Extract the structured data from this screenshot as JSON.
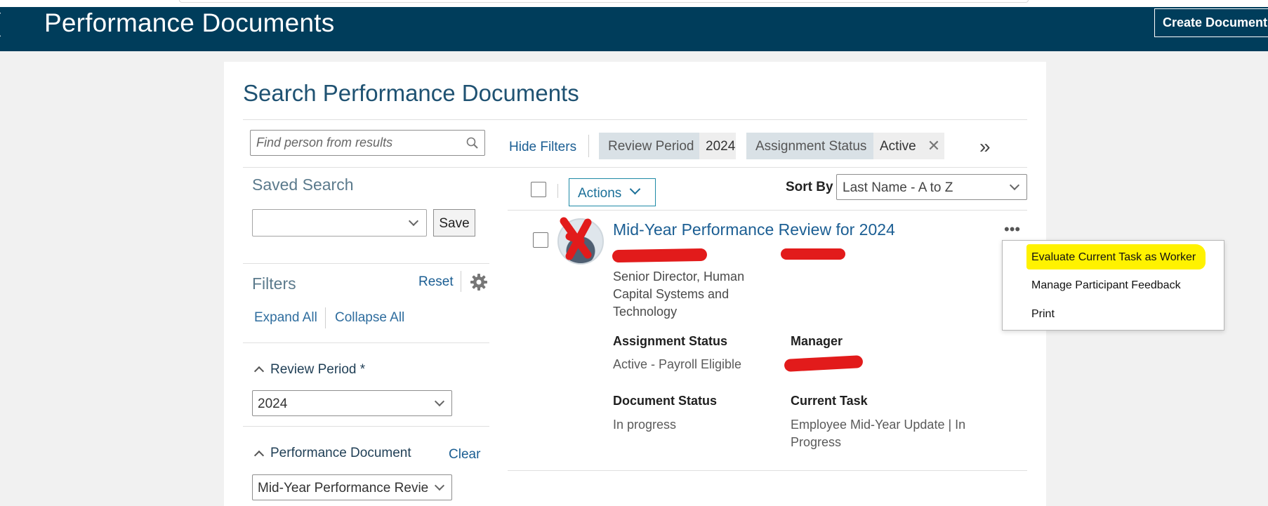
{
  "header": {
    "title": "Performance Documents",
    "create_button": "Create Document"
  },
  "search": {
    "title": "Search Performance Documents",
    "find_placeholder": "Find person from results"
  },
  "filter_bar": {
    "hide_filters": "Hide Filters",
    "chips": [
      {
        "label": "Review Period",
        "value": "2024"
      },
      {
        "label": "Assignment Status",
        "value": "Active"
      }
    ],
    "remove_symbol": "✕",
    "overflow_symbol": "»"
  },
  "saved_search": {
    "label": "Saved Search",
    "selected": "",
    "save_button": "Save"
  },
  "filters": {
    "label": "Filters",
    "reset": "Reset",
    "expand_all": "Expand All",
    "collapse_all": "Collapse All",
    "sections": [
      {
        "label": "Review Period *",
        "value": "2024"
      },
      {
        "label": "Performance Document",
        "clear": "Clear",
        "value": "Mid-Year Performance Revie"
      }
    ]
  },
  "results": {
    "actions_button": "Actions",
    "sort_label": "Sort By",
    "sort_value": "Last Name - A to Z",
    "item": {
      "title": "Mid-Year Performance Review for 2024",
      "job_title": "Senior Director, Human Capital Systems and Technology",
      "assignment_status_label": "Assignment Status",
      "assignment_status_value": "Active - Payroll Eligible",
      "manager_label": "Manager",
      "document_status_label": "Document Status",
      "document_status_value": "In progress",
      "current_task_label": "Current Task",
      "current_task_value": "Employee Mid-Year Update | In Progress"
    }
  },
  "row_menu": {
    "items": [
      "Evaluate Current Task as Worker",
      "Manage Participant Feedback",
      "Print"
    ],
    "highlight_color": "#fff200"
  },
  "colors": {
    "header_bg": "#003d5b",
    "link": "#1b5e93",
    "redaction": "#e21b1b"
  }
}
